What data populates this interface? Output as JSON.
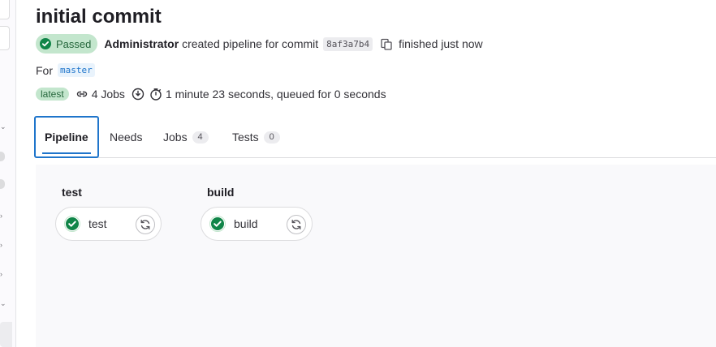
{
  "pipeline": {
    "title": "initial commit",
    "status_label": "Passed",
    "author": "Administrator",
    "action_text": "created pipeline for commit",
    "commit_sha": "8af3a7b4",
    "finished_text": "finished just now",
    "for_label": "For",
    "branch": "master",
    "latest_label": "latest",
    "jobs_count_text": "4 Jobs",
    "duration_text": "1 minute 23 seconds, queued for 0 seconds"
  },
  "tabs": [
    {
      "label": "Pipeline",
      "count": null,
      "active": true
    },
    {
      "label": "Needs",
      "count": null,
      "active": false
    },
    {
      "label": "Jobs",
      "count": "4",
      "active": false
    },
    {
      "label": "Tests",
      "count": "0",
      "active": false
    }
  ],
  "stages": [
    {
      "title": "test",
      "jobs": [
        {
          "name": "test",
          "status": "success"
        }
      ]
    },
    {
      "title": "build",
      "jobs": [
        {
          "name": "build",
          "status": "success"
        }
      ]
    }
  ],
  "colors": {
    "success": "#108548",
    "success_bg": "#c3e6cd",
    "accent": "#1f75cb"
  },
  "icons": {
    "status": "check-circle-icon",
    "copy": "copy-icon",
    "jobs": "link-icon",
    "info": "info-icon",
    "timer": "timer-icon",
    "retry": "retry-icon"
  }
}
